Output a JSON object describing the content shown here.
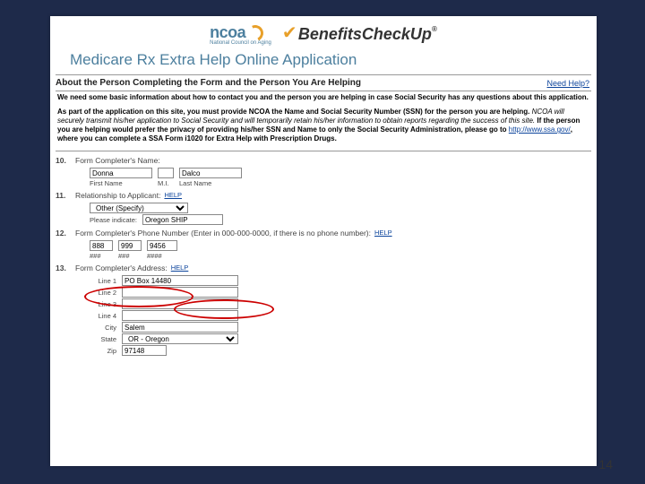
{
  "slide_number": "14",
  "logos": {
    "ncoa_text": "ncoa",
    "ncoa_sub": "National Council on Aging",
    "bcu_prefix": "Benefits",
    "bcu_suffix": "CheckUp",
    "bcu_reg": "®"
  },
  "app_title": "Medicare Rx Extra Help Online Application",
  "section_title": "About the Person Completing the Form and the Person You Are Helping",
  "need_help": "Need Help?",
  "intro": {
    "p1": "We need some basic information about how to contact you and the person you are helping in case Social Security has any questions about this application.",
    "p2a": "As part of the application on this site, you must provide NCOA the Name and Social Security Number (SSN) for the person you are helping.",
    "p2b": "NCOA will securely transmit his/her application to Social Security and will temporarily retain his/her information to obtain reports regarding the success of this site.",
    "p2c": "If the person you are helping would prefer the privacy of providing his/her SSN and Name to only the Social Security Administration, please go to ",
    "link": "http://www.ssa.gov/",
    "p2d": ", where you can complete a SSA Form i1020 for Extra Help with Prescription Drugs."
  },
  "q10": {
    "num": "10.",
    "label": "Form Completer's Name:",
    "first": "Donna",
    "mi": "",
    "last": "Dalco",
    "first_lbl": "First Name",
    "mi_lbl": "M.I.",
    "last_lbl": "Last Name"
  },
  "q11": {
    "num": "11.",
    "label": "Relationship to Applicant:",
    "help": "HELP",
    "dropdown": "Other (Specify)",
    "indicate_lbl": "Please indicate:",
    "indicate_val": "Oregon SHIP"
  },
  "q12": {
    "num": "12.",
    "label": "Form Completer's Phone Number (Enter in 000-000-0000, if there is no phone number):",
    "help": "HELP",
    "p1": "888",
    "p2": "999",
    "p3": "9456",
    "m1": "###",
    "m2": "###",
    "m3": "####"
  },
  "q13": {
    "num": "13.",
    "label": "Form Completer's Address:",
    "help": "HELP",
    "line1_lbl": "Line 1",
    "line1": "PO Box 14480",
    "line2_lbl": "Line 2",
    "line2": "",
    "line3_lbl": "Line 3",
    "line3": "",
    "line4_lbl": "Line 4",
    "line4": "",
    "city_lbl": "City",
    "city": "Salem",
    "state_lbl": "State",
    "state": "OR - Oregon",
    "zip_lbl": "Zip",
    "zip": "97148"
  }
}
